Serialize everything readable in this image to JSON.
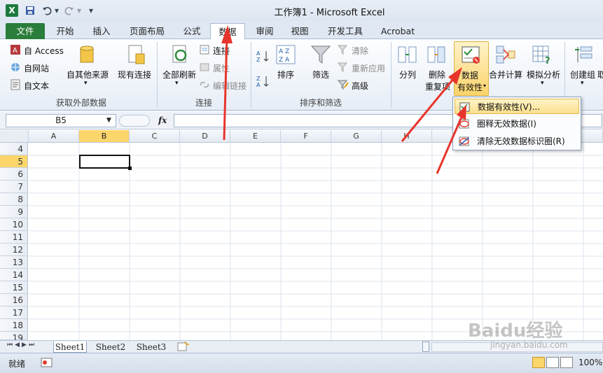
{
  "window": {
    "title": "工作簿1 - Microsoft Excel"
  },
  "qat": {
    "logo": "X",
    "save_icon": "save-icon",
    "undo_icon": "undo-icon",
    "redo_icon": "redo-icon"
  },
  "tabs": [
    "文件",
    "开始",
    "插入",
    "页面布局",
    "公式",
    "数据",
    "审阅",
    "视图",
    "开发工具",
    "Acrobat"
  ],
  "ribbon": {
    "get_external": {
      "label": "获取外部数据",
      "access": "自 Access",
      "web": "自网站",
      "text": "自文本",
      "other": "自其他来源",
      "existing": "现有连接"
    },
    "connections": {
      "label": "连接",
      "refresh_all": "全部刷新",
      "connections": "连接",
      "properties": "属性",
      "edit_links": "编辑链接"
    },
    "sort_filter": {
      "label": "排序和筛选",
      "sort": "排序",
      "filter": "筛选",
      "clear": "清除",
      "reapply": "重新应用",
      "advanced": "高级"
    },
    "data_tools": {
      "text_to_columns": "分列",
      "remove_dup_1": "删除",
      "remove_dup_2": "重复项",
      "validation_1": "数据",
      "validation_2": "有效性",
      "consolidate": "合并计算",
      "whatif": "模拟分析"
    },
    "outline": {
      "group": "创建组",
      "more": "取"
    }
  },
  "formula_bar": {
    "name_box": "B5",
    "fx": "fx"
  },
  "columns": [
    "A",
    "B",
    "C",
    "D",
    "E",
    "F",
    "G",
    "H"
  ],
  "rows": [
    "4",
    "5",
    "6",
    "7",
    "8",
    "9",
    "10",
    "11",
    "12",
    "13",
    "14",
    "15",
    "16",
    "17",
    "18",
    "19"
  ],
  "selected_cell": {
    "col": "B",
    "row": "5"
  },
  "dropdown": {
    "items": [
      "数据有效性(V)...",
      "圈释无效数据(I)",
      "清除无效数据标识圈(R)"
    ]
  },
  "sheets": [
    "Sheet1",
    "Sheet2",
    "Sheet3"
  ],
  "status": {
    "ready": "就绪",
    "zoom": "100%"
  },
  "watermark": {
    "brand": "Baidu经验",
    "url": "jingyan.baidu.com"
  },
  "colors": {
    "accent_green": "#2a7d3a",
    "selection": "#fbd66b",
    "arrow_red": "#e8352b"
  }
}
